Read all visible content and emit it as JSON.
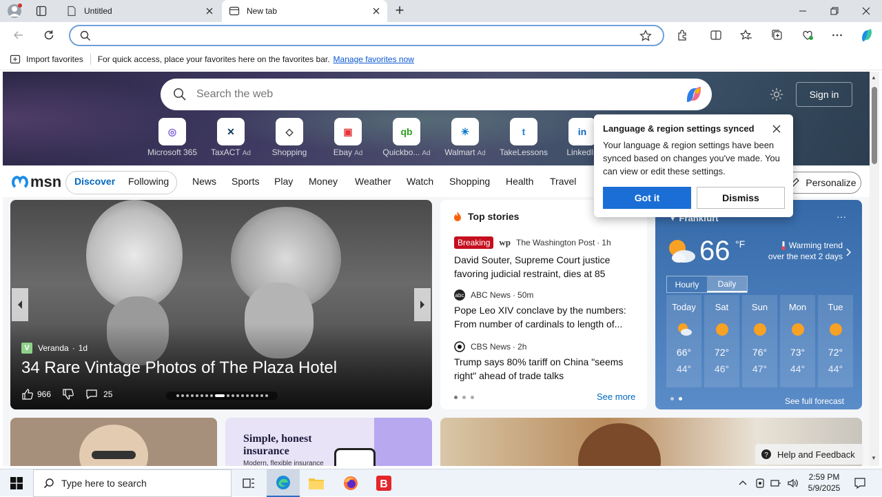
{
  "browser": {
    "tabs": [
      {
        "title": "Untitled",
        "active": false
      },
      {
        "title": "New tab",
        "active": true
      }
    ],
    "new_tab_symbol": "+",
    "address_value": ""
  },
  "favorites_bar": {
    "import_label": "Import favorites",
    "hint": "For quick access, place your favorites here on the favorites bar.",
    "manage_link": "Manage favorites now"
  },
  "hero": {
    "search_placeholder": "Search the web",
    "sign_in": "Sign in",
    "quick_links": [
      {
        "label": "Microsoft 365",
        "ad": "",
        "glyph": "◎",
        "color": "#7b5cd6"
      },
      {
        "label": "TaxACT",
        "ad": "Ad",
        "glyph": "✕",
        "color": "#0b3a5c"
      },
      {
        "label": "Shopping",
        "ad": "",
        "glyph": "◇",
        "color": "#333333"
      },
      {
        "label": "Ebay",
        "ad": "Ad",
        "glyph": "▣",
        "color": "#e53238"
      },
      {
        "label": "Quickbo...",
        "ad": "Ad",
        "glyph": "qb",
        "color": "#2ca01c"
      },
      {
        "label": "Walmart",
        "ad": "Ad",
        "glyph": "✳",
        "color": "#0071ce"
      },
      {
        "label": "TakeLessons",
        "ad": "",
        "glyph": "t",
        "color": "#2a7fd4"
      },
      {
        "label": "LinkedIn",
        "ad": "",
        "glyph": "in",
        "color": "#0a66c2"
      }
    ]
  },
  "nav": {
    "logo": "msn",
    "discover": "Discover",
    "following": "Following",
    "links": [
      "News",
      "Sports",
      "Play",
      "Money",
      "Weather",
      "Watch",
      "Shopping",
      "Health",
      "Travel"
    ],
    "personalize": "Personalize"
  },
  "feature": {
    "source": "Veranda",
    "age": "1d",
    "title": "34 Rare Vintage Photos of The Plaza Hotel",
    "likes": "966",
    "comments": "25",
    "carousel_dots": 18,
    "carousel_active": 8
  },
  "top_stories": {
    "header": "Top stories",
    "stories": [
      {
        "badge": "Breaking",
        "source": "The Washington Post",
        "age": "1h",
        "title": "David Souter, Supreme Court justice favoring judicial restraint, dies at 85"
      },
      {
        "badge": "",
        "source": "ABC News",
        "age": "50m",
        "title": "Pope Leo XIV conclave by the numbers: From number of cardinals to length of..."
      },
      {
        "badge": "",
        "source": "CBS News",
        "age": "2h",
        "title": "Trump says 80% tariff on China \"seems right\" ahead of trade talks"
      }
    ],
    "see_more": "See more"
  },
  "weather": {
    "location": "Frankfurt",
    "temp": "66",
    "unit": "°F",
    "trend_line1": "Warming trend",
    "trend_line2": "over the next 2 days",
    "toggle": [
      "Hourly",
      "Daily"
    ],
    "days": [
      {
        "name": "Today",
        "high": "66°",
        "low": "44°",
        "icon": "partly-cloudy-icon"
      },
      {
        "name": "Sat",
        "high": "72°",
        "low": "46°",
        "icon": "sun-icon"
      },
      {
        "name": "Sun",
        "high": "76°",
        "low": "47°",
        "icon": "sun-icon"
      },
      {
        "name": "Mon",
        "high": "73°",
        "low": "44°",
        "icon": "sun-icon"
      },
      {
        "name": "Tue",
        "high": "72°",
        "low": "44°",
        "icon": "sun-icon"
      }
    ],
    "see_full": "See full forecast"
  },
  "popup": {
    "title": "Language & region settings synced",
    "body": "Your language & region settings have been synced based on changes you've made. You can view or edit these settings.",
    "primary": "Got it",
    "secondary": "Dismiss"
  },
  "ad_card": {
    "title": "Simple, honest insurance",
    "subtitle": "Modern, flexible insurance"
  },
  "help": "Help and Feedback",
  "taskbar": {
    "search_placeholder": "Type here to search",
    "time": "2:59 PM",
    "date": "5/9/2025"
  },
  "colors": {
    "accent": "#0067c0",
    "got_it": "#1a6ed6",
    "breaking": "#c50f1f"
  }
}
